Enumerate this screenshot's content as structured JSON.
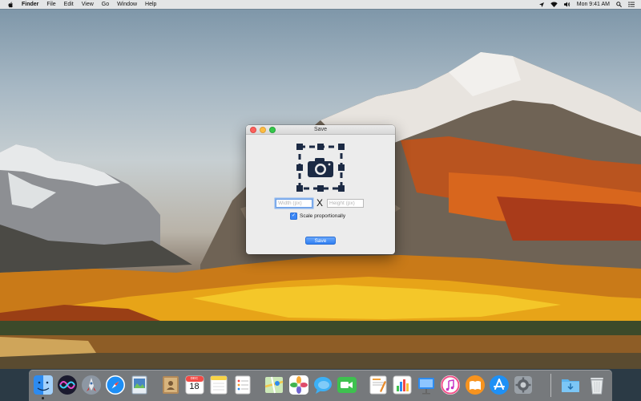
{
  "menubar": {
    "items": [
      "Finder",
      "File",
      "Edit",
      "View",
      "Go",
      "Window",
      "Help"
    ],
    "clock": "Mon 9:41 AM"
  },
  "window": {
    "title": "Save",
    "width_placeholder": "Width (px)",
    "height_placeholder": "Height (px)",
    "times_symbol": "X",
    "scale_label": "Scale proportionally",
    "scale_checked": true,
    "save_label": "Save"
  },
  "dock": {
    "calendar_month": "DEC",
    "calendar_day": "18",
    "apps": [
      "finder",
      "siri",
      "launchpad",
      "safari",
      "preview",
      "notes-book",
      "calendar",
      "notes",
      "reminders",
      "maps",
      "photos",
      "messages",
      "facetime",
      "pages",
      "numbers",
      "keynote",
      "itunes",
      "ibooks",
      "app-store",
      "system-preferences",
      "downloads-folder",
      "trash"
    ]
  },
  "colors": {
    "accent": "#3b87f6",
    "close": "#fc605c",
    "minimize": "#fdbc40",
    "maximize": "#34c84a"
  }
}
